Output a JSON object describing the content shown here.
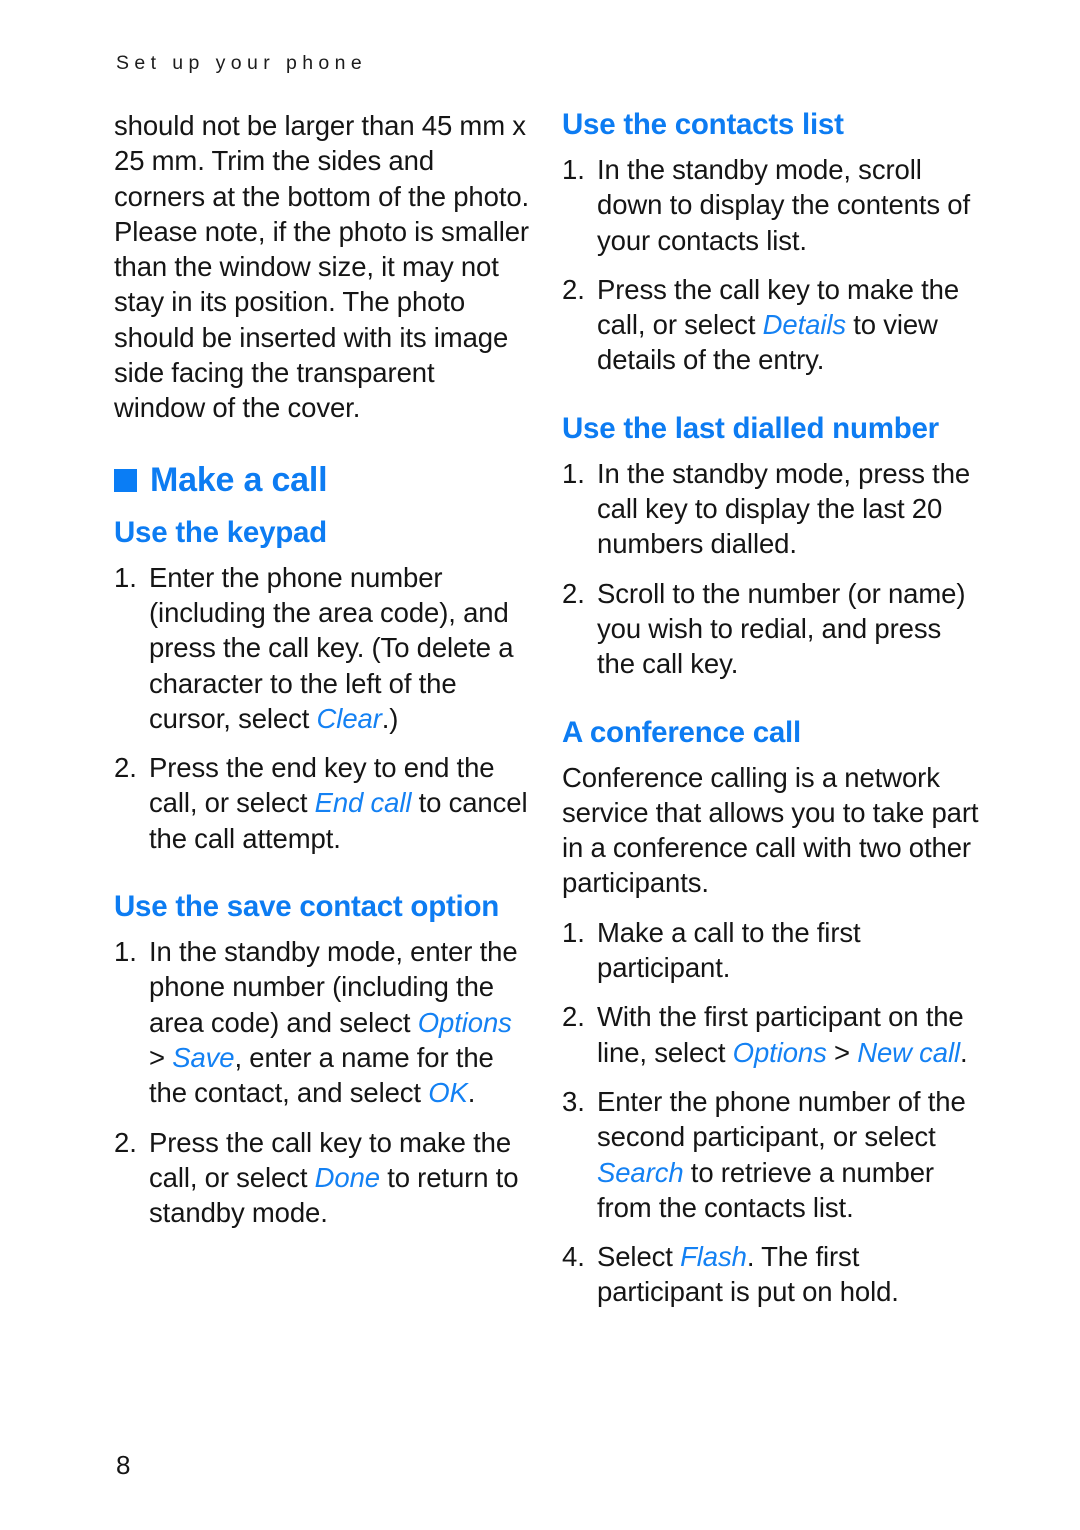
{
  "document": {
    "running_header": "Set up your phone",
    "page_number": "8",
    "accent_color": "#0d7cf2",
    "ui_label_color": "#1481f3",
    "text_color": "#151515"
  },
  "left_column": {
    "continued_paragraph": "should not be larger than 45 mm x 25 mm. Trim the sides and corners at the bottom of the photo. Please note, if the photo is smaller than the window size, it may not stay in its position. The photo should be inserted with its image side facing the transparent window of the cover.",
    "chapter": {
      "bullet_icon": "filled-square-icon",
      "title": "Make a call"
    },
    "sections": [
      {
        "heading": "Use the keypad",
        "steps": [
          {
            "number": "1.",
            "parts": [
              {
                "type": "text",
                "value": "Enter the phone number (including the area code), and press the call key. (To delete a character to the left of the cursor, select "
              },
              {
                "type": "ui",
                "value": "Clear"
              },
              {
                "type": "text",
                "value": ".)"
              }
            ]
          },
          {
            "number": "2.",
            "parts": [
              {
                "type": "text",
                "value": "Press the end key to end the call, or select "
              },
              {
                "type": "ui",
                "value": "End call"
              },
              {
                "type": "text",
                "value": " to cancel the call attempt."
              }
            ]
          }
        ]
      },
      {
        "heading": "Use the save contact option",
        "steps": [
          {
            "number": "1.",
            "parts": [
              {
                "type": "text",
                "value": "In the standby mode, enter the phone number (including the area code) and select "
              },
              {
                "type": "ui",
                "value": "Options"
              },
              {
                "type": "text",
                "value": " > "
              },
              {
                "type": "ui",
                "value": "Save"
              },
              {
                "type": "text",
                "value": ", enter a name for the the contact, and select "
              },
              {
                "type": "ui",
                "value": "OK"
              },
              {
                "type": "text",
                "value": "."
              }
            ]
          },
          {
            "number": "2.",
            "parts": [
              {
                "type": "text",
                "value": "Press the call key to make the call, or select "
              },
              {
                "type": "ui",
                "value": "Done"
              },
              {
                "type": "text",
                "value": " to return to standby mode."
              }
            ]
          }
        ]
      }
    ]
  },
  "right_column": {
    "sections": [
      {
        "heading": "Use the contacts list",
        "steps": [
          {
            "number": "1.",
            "parts": [
              {
                "type": "text",
                "value": "In the standby mode, scroll down to display the contents of your contacts list."
              }
            ]
          },
          {
            "number": "2.",
            "parts": [
              {
                "type": "text",
                "value": "Press the call key to make the call, or select "
              },
              {
                "type": "ui",
                "value": "Details"
              },
              {
                "type": "text",
                "value": " to view details of the entry."
              }
            ]
          }
        ]
      },
      {
        "heading": "Use the last dialled number",
        "steps": [
          {
            "number": "1.",
            "parts": [
              {
                "type": "text",
                "value": "In the standby mode, press the call key to display the last 20 numbers dialled."
              }
            ]
          },
          {
            "number": "2.",
            "parts": [
              {
                "type": "text",
                "value": "Scroll to the number (or name) you wish to redial, and press the call key."
              }
            ]
          }
        ]
      },
      {
        "heading": "A conference call",
        "intro": "Conference calling is a network service that allows you to take part in a conference call with two other participants.",
        "steps": [
          {
            "number": "1.",
            "parts": [
              {
                "type": "text",
                "value": "Make a call to the first participant."
              }
            ]
          },
          {
            "number": "2.",
            "parts": [
              {
                "type": "text",
                "value": "With the first participant on the line, select "
              },
              {
                "type": "ui",
                "value": "Options"
              },
              {
                "type": "text",
                "value": " > "
              },
              {
                "type": "ui",
                "value": "New call"
              },
              {
                "type": "text",
                "value": "."
              }
            ]
          },
          {
            "number": "3.",
            "parts": [
              {
                "type": "text",
                "value": "Enter the phone number of the second participant, or select "
              },
              {
                "type": "ui",
                "value": "Search"
              },
              {
                "type": "text",
                "value": " to retrieve a number from the contacts list."
              }
            ]
          },
          {
            "number": "4.",
            "parts": [
              {
                "type": "text",
                "value": "Select "
              },
              {
                "type": "ui",
                "value": "Flash"
              },
              {
                "type": "text",
                "value": ". The first participant is put on hold."
              }
            ]
          }
        ]
      }
    ]
  }
}
